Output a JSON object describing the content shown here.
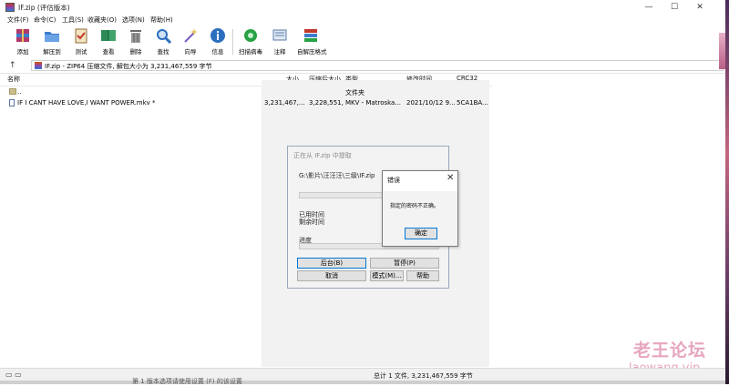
{
  "window": {
    "title": "IF.zip (评估版本)",
    "minimize": "—",
    "maximize": "☐",
    "close": "✕"
  },
  "menu": [
    "文件(F)",
    "命令(C)",
    "工具(S)",
    "收藏夹(O)",
    "选项(N)",
    "帮助(H)"
  ],
  "toolbar": [
    {
      "label": "添加",
      "icon": "add-archive-icon",
      "color": "#b03a6a"
    },
    {
      "label": "解压到",
      "icon": "extract-folder-icon",
      "color": "#3d7ccc"
    },
    {
      "label": "测试",
      "icon": "test-clipboard-icon",
      "color": "#c0392b"
    },
    {
      "label": "查看",
      "icon": "view-book-icon",
      "color": "#2e8b57"
    },
    {
      "label": "删除",
      "icon": "trash-icon",
      "color": "#6b6b6b"
    },
    {
      "label": "查找",
      "icon": "magnifier-icon",
      "color": "#2c6fbf"
    },
    {
      "label": "向导",
      "icon": "wizard-wand-icon",
      "color": "#7a5cc0"
    },
    {
      "label": "信息",
      "icon": "info-icon",
      "color": "#2c6fbf"
    },
    {
      "label": "扫描病毒",
      "icon": "virus-scan-icon",
      "color": "#27a244"
    },
    {
      "label": "注释",
      "icon": "comment-icon",
      "color": "#5b7da8"
    },
    {
      "label": "自解压格式",
      "icon": "sfx-archive-icon",
      "color": "#c0392b"
    }
  ],
  "path": {
    "up": "↑",
    "text": "IF.zip - ZIP64 压缩文件, 解包大小为 3,231,467,559 字节"
  },
  "columns": [
    "名称",
    "大小",
    "压缩后大小",
    "类型",
    "修改时间",
    "CRC32"
  ],
  "rows": [
    {
      "name": "..",
      "size": "",
      "packed": "",
      "type": "文件夹",
      "modified": "",
      "crc": "",
      "icon": "folder-icon"
    },
    {
      "name": "IF I CANT HAVE LOVE,I WANT POWER.mkv *",
      "size": "3,231,467,...",
      "packed": "3,228,551,...",
      "type": "MKV - Matroska...",
      "modified": "2021/10/12 9...",
      "crc": "5CA1BA...",
      "icon": "video-file-icon"
    }
  ],
  "extract_dialog": {
    "title": "正在从 IF.zip 中提取",
    "path": "G:\\影片\\汪汪汪\\三级\\IF.zip",
    "elapsed_label": "已用时间",
    "remaining_label": "剩余时间",
    "progress_label": "进度",
    "buttons": {
      "background": "后台(B)",
      "pause": "暂停(P)",
      "cancel": "取消",
      "mode": "模式(M)...",
      "help": "帮助"
    }
  },
  "error_dialog": {
    "title": "错误",
    "message": "指定的密码不正确。",
    "ok": "确定"
  },
  "status": {
    "left_icons": "▭ ▭",
    "center": "总计 1 文件, 3,231,467,559 字节"
  },
  "watermark": {
    "line1": "老王论坛",
    "line2": "laowang.vip"
  },
  "below_text": "第 1 版本选项请使用设置 (F) 的该设置"
}
